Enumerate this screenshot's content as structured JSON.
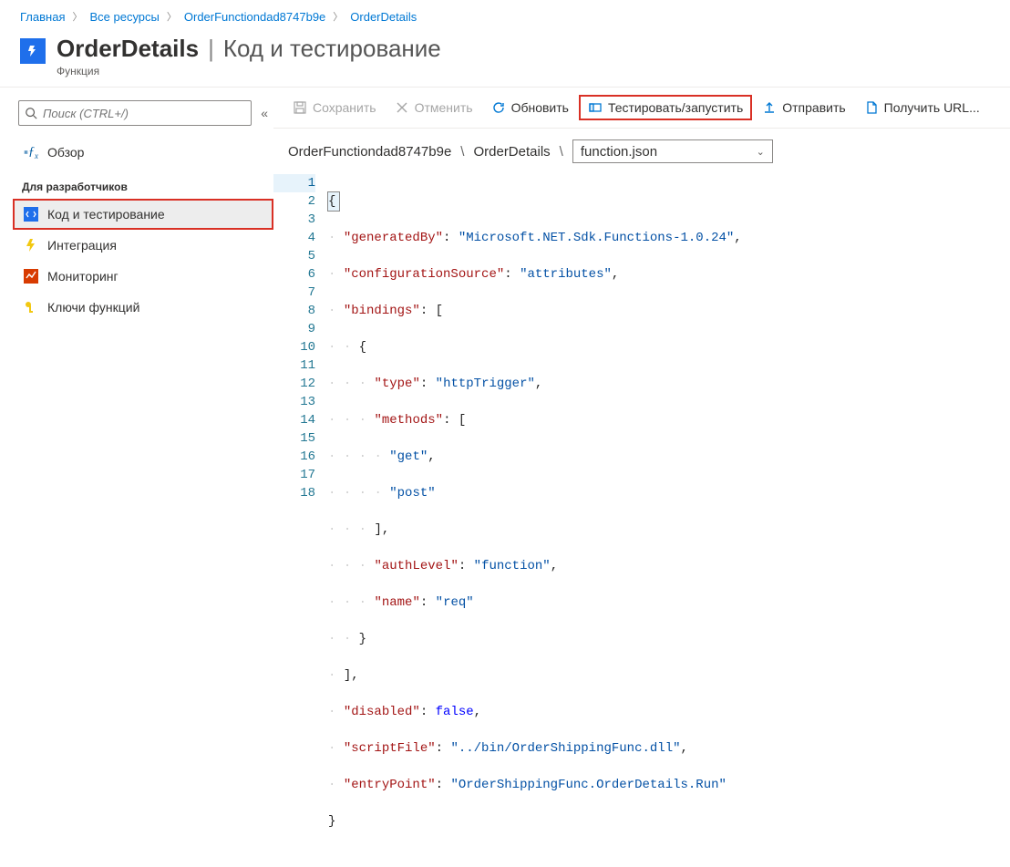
{
  "breadcrumb": {
    "home": "Главная",
    "all": "Все ресурсы",
    "func": "OrderFunctiondad8747b9e",
    "details": "OrderDetails"
  },
  "header": {
    "title": "OrderDetails",
    "section": "Код и тестирование",
    "subtitle": "Функция"
  },
  "sidebar": {
    "search_placeholder": "Поиск (CTRL+/)",
    "overview": "Обзор",
    "dev_heading": "Для разработчиков",
    "items": {
      "code": "Код и тестирование",
      "integration": "Интеграция",
      "monitoring": "Мониторинг",
      "keys": "Ключи функций"
    }
  },
  "toolbar": {
    "save": "Сохранить",
    "cancel": "Отменить",
    "refresh": "Обновить",
    "test": "Тестировать/запустить",
    "send": "Отправить",
    "geturl": "Получить URL..."
  },
  "pathbar": {
    "func": "OrderFunctiondad8747b9e",
    "details": "OrderDetails",
    "file": "function.json"
  },
  "code": {
    "generatedBy_k": "\"generatedBy\"",
    "generatedBy_v": "\"Microsoft.NET.Sdk.Functions-1.0.24\"",
    "configurationSource_k": "\"configurationSource\"",
    "configurationSource_v": "\"attributes\"",
    "bindings_k": "\"bindings\"",
    "type_k": "\"type\"",
    "type_v": "\"httpTrigger\"",
    "methods_k": "\"methods\"",
    "m_get": "\"get\"",
    "m_post": "\"post\"",
    "authLevel_k": "\"authLevel\"",
    "authLevel_v": "\"function\"",
    "name_k": "\"name\"",
    "name_v": "\"req\"",
    "disabled_k": "\"disabled\"",
    "disabled_v": "false",
    "scriptFile_k": "\"scriptFile\"",
    "scriptFile_v": "\"../bin/OrderShippingFunc.dll\"",
    "entryPoint_k": "\"entryPoint\"",
    "entryPoint_v": "\"OrderShippingFunc.OrderDetails.Run\""
  }
}
